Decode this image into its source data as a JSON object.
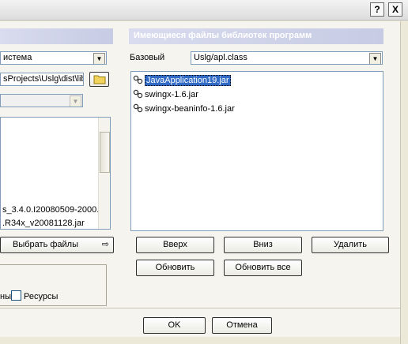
{
  "window": {
    "help_glyph": "?",
    "close_glyph": "X"
  },
  "left": {
    "system_select_value": "истема",
    "path_value": "sProjects\\Uslg\\dist\\lib",
    "disabled_select_value": "",
    "list_items": [
      "s_3.4.0.I20080509-2000.jar",
      ".R34x_v20081128.jar"
    ],
    "choose_files_label": "Выбрать файлы",
    "checkbox_cut_label": "ны",
    "resources_label": "Ресурсы"
  },
  "right": {
    "section_title": "Имеющиеся файлы библиотек программ",
    "base_label": "Базовый",
    "base_select_value": "Uslg/apl.class",
    "files": [
      {
        "name": "JavaApplication19.jar",
        "selected": true
      },
      {
        "name": "swingx-1.6.jar",
        "selected": false
      },
      {
        "name": "swingx-beaninfo-1.6.jar",
        "selected": false
      }
    ],
    "buttons": {
      "up": "Вверх",
      "down": "Вниз",
      "delete": "Удалить",
      "refresh": "Обновить",
      "refresh_all": "Обновить все"
    }
  },
  "footer": {
    "ok": "OK",
    "cancel": "Отмена"
  },
  "colors": {
    "selection": "#316ac5",
    "header_band": "#c7cbe4",
    "dialog_bg": "#ece9d8"
  }
}
